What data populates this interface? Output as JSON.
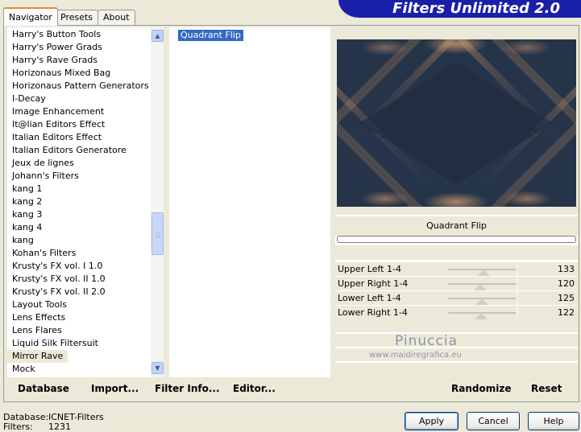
{
  "tabs": [
    {
      "label": "Navigator",
      "active": true
    },
    {
      "label": "Presets",
      "active": false
    },
    {
      "label": "About",
      "active": false
    }
  ],
  "banner": {
    "title": "Filters Unlimited 2.0"
  },
  "categories": [
    "Harry's Button Tools",
    "Harry's Power Grads",
    "Harry's Rave Grads",
    "Horizonaus Mixed Bag",
    "Horizonaus Pattern Generators",
    "I-Decay",
    "Image Enhancement",
    "It@lian Editors Effect",
    "Italian Editors Effect",
    "Italian Editors Generatore",
    "Jeux de lignes",
    "Johann's Filters",
    "kang 1",
    "kang 2",
    "kang 3",
    "kang 4",
    "kang",
    "Kohan's Filters",
    "Krusty's FX vol. I 1.0",
    "Krusty's FX vol. II 1.0",
    "Krusty's FX vol. II 2.0",
    "Layout Tools",
    "Lens Effects",
    "Lens Flares",
    "Liquid Silk Filtersuit",
    "Mirror Rave",
    "Mock"
  ],
  "selected_category": "Mirror Rave",
  "filters": [
    "Quadrant Flip"
  ],
  "selected_filter": "Quadrant Flip",
  "filter_title": "Quadrant Flip",
  "parameters": [
    {
      "label": "Upper Left 1-4",
      "value": "133",
      "level": 0.52
    },
    {
      "label": "Upper Right 1-4",
      "value": "120",
      "level": 0.47
    },
    {
      "label": "Lower Left 1-4",
      "value": "125",
      "level": 0.49
    },
    {
      "label": "Lower Right 1-4",
      "value": "122",
      "level": 0.48
    }
  ],
  "watermark": {
    "name": "Pinuccia",
    "url": "www.maidiregrafica.eu"
  },
  "bottom_buttons": {
    "database": "Database",
    "import": "Import...",
    "filter_info": "Filter Info...",
    "editor": "Editor...",
    "randomize": "Randomize",
    "reset": "Reset"
  },
  "status": {
    "database_label": "Database:",
    "database_value": "ICNET-Filters",
    "filters_label": "Filters:",
    "filters_value": "1231"
  },
  "dialog_buttons": {
    "apply": "Apply",
    "cancel": "Cancel",
    "help": "Help"
  },
  "colors": {
    "banner": "#1a1faa",
    "selection": "#316ac5",
    "preview_bg": "#253449",
    "preview_glow": "#e0a270"
  }
}
